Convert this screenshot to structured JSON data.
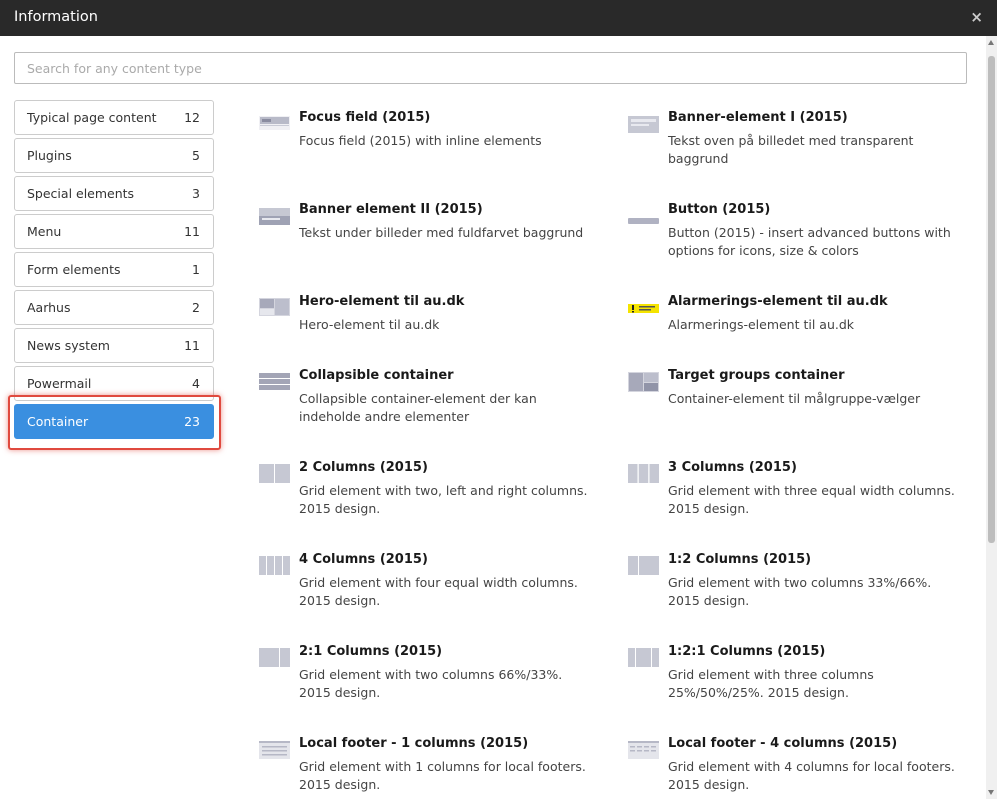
{
  "window": {
    "title": "Information",
    "close_glyph": "×"
  },
  "search": {
    "placeholder": "Search for any content type",
    "value": ""
  },
  "categories": [
    {
      "label": "Typical page content",
      "count": "12"
    },
    {
      "label": "Plugins",
      "count": "5"
    },
    {
      "label": "Special elements",
      "count": "3"
    },
    {
      "label": "Menu",
      "count": "11"
    },
    {
      "label": "Form elements",
      "count": "1"
    },
    {
      "label": "Aarhus",
      "count": "2"
    },
    {
      "label": "News system",
      "count": "11"
    },
    {
      "label": "Powermail",
      "count": "4"
    },
    {
      "label": "Container",
      "count": "23",
      "active": true
    }
  ],
  "items": [
    {
      "title": "Focus field (2015)",
      "desc": "Focus field (2015) with inline elements",
      "icon": "focus-field-icon"
    },
    {
      "title": "Banner-element I (2015)",
      "desc": "Tekst oven på billedet med transparent baggrund",
      "icon": "banner-element-1-icon"
    },
    {
      "title": "Banner element II (2015)",
      "desc": "Tekst under billeder med fuldfarvet baggrund",
      "icon": "banner-element-2-icon"
    },
    {
      "title": "Button (2015)",
      "desc": "Button (2015) - insert advanced buttons with options for icons, size & colors",
      "icon": "button-icon"
    },
    {
      "title": "Hero-element til au.dk",
      "desc": "Hero-element til au.dk",
      "icon": "hero-element-icon"
    },
    {
      "title": "Alarmerings-element til au.dk",
      "desc": "Alarmerings-element til au.dk",
      "icon": "alert-element-icon"
    },
    {
      "title": "Collapsible container",
      "desc": "Collapsible container-element der kan indeholde andre elementer",
      "icon": "collapsible-container-icon"
    },
    {
      "title": "Target groups container",
      "desc": "Container-element til målgruppe-vælger",
      "icon": "target-groups-icon"
    },
    {
      "title": "2 Columns (2015)",
      "desc": "Grid element with two, left and right columns. 2015 design.",
      "icon": "two-columns-icon"
    },
    {
      "title": "3 Columns (2015)",
      "desc": "Grid element with three equal width columns. 2015 design.",
      "icon": "three-columns-icon"
    },
    {
      "title": "4 Columns (2015)",
      "desc": "Grid element with four equal width columns. 2015 design.",
      "icon": "four-columns-icon"
    },
    {
      "title": "1:2 Columns (2015)",
      "desc": "Grid element with two columns 33%/66%. 2015 design.",
      "icon": "one-two-columns-icon"
    },
    {
      "title": "2:1 Columns (2015)",
      "desc": "Grid element with two columns 66%/33%. 2015 design.",
      "icon": "two-one-columns-icon"
    },
    {
      "title": "1:2:1 Columns (2015)",
      "desc": "Grid element with three columns 25%/50%/25%. 2015 design.",
      "icon": "one-two-one-columns-icon"
    },
    {
      "title": "Local footer - 1 columns (2015)",
      "desc": "Grid element with 1 columns for local footers. 2015 design.",
      "icon": "local-footer-1-icon"
    },
    {
      "title": "Local footer - 4 columns (2015)",
      "desc": "Grid element with 4 columns for local footers. 2015 design.",
      "icon": "local-footer-4-icon"
    }
  ],
  "colors": {
    "accent": "#3a8fe0",
    "titlebar": "#292929",
    "highlight": "#e04a3f",
    "alert_yellow": "#f5e400"
  }
}
